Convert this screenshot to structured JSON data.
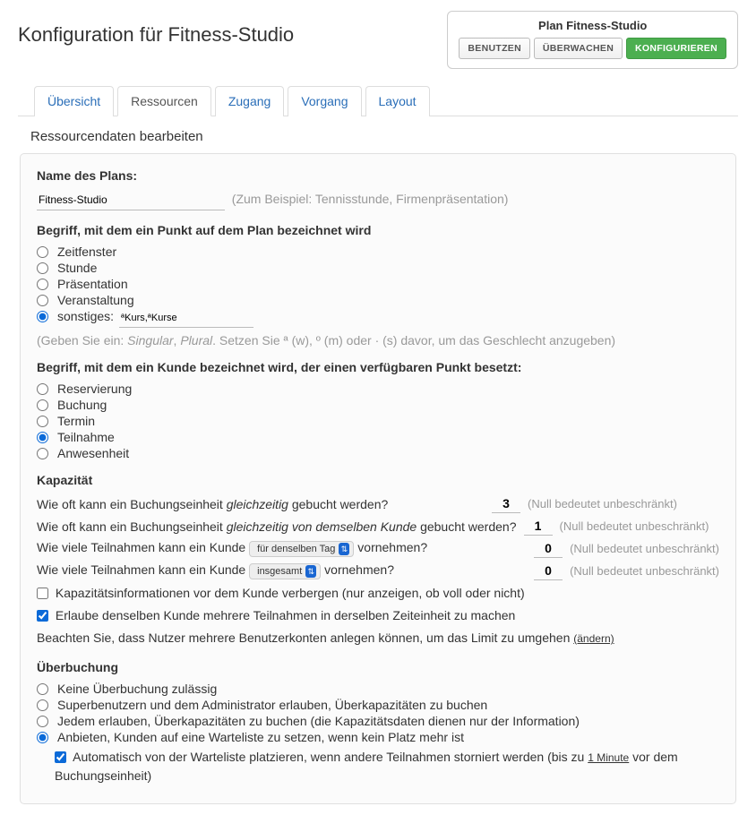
{
  "page_title": "Konfiguration für Fitness-Studio",
  "plan_box": {
    "title": "Plan Fitness-Studio",
    "buttons": {
      "use": "Benutzen",
      "watch": "Überwachen",
      "configure": "Konfigurieren"
    }
  },
  "tabs": [
    "Übersicht",
    "Ressourcen",
    "Zugang",
    "Vorgang",
    "Layout"
  ],
  "active_tab": 1,
  "subheading": "Ressourcendaten bearbeiten",
  "name": {
    "label": "Name des Plans:",
    "value": "Fitness-Studio",
    "hint": "(Zum Beispiel: Tennisstunde, Firmenpräsentation)"
  },
  "point_term": {
    "label": "Begriff, mit dem ein Punkt auf dem Plan bezeichnet wird",
    "options": [
      "Zeitfenster",
      "Stunde",
      "Präsentation",
      "Veranstaltung"
    ],
    "other_label": "sonstiges:",
    "other_value": "ªKurs,ªKurse",
    "hint_prefix": "(Geben Sie ein: ",
    "hint_mid1": "Singular",
    "hint_sep": ", ",
    "hint_mid2": "Plural",
    "hint_suffix": ". Setzen Sie ª (w), º (m) oder · (s) davor, um das Geschlecht anzugeben)",
    "selected": "other"
  },
  "customer_term": {
    "label": "Begriff, mit dem ein Kunde bezeichnet wird, der einen verfügbaren Punkt besetzt:",
    "options": [
      "Reservierung",
      "Buchung",
      "Termin",
      "Teilnahme",
      "Anwesenheit"
    ],
    "selected": 3
  },
  "capacity": {
    "title": "Kapazität",
    "row1_a": "Wie oft kann ein Buchungseinheit ",
    "row1_b": "gleichzeitig",
    "row1_c": " gebucht werden?",
    "val1": "3",
    "row2_a": "Wie oft kann ein Buchungseinheit ",
    "row2_b": "gleichzeitig von demselben Kunde",
    "row2_c": " gebucht werden?",
    "val2": "1",
    "row3_a": "Wie viele Teilnahmen kann ein Kunde ",
    "row3_b": " vornehmen?",
    "sel3": "für denselben Tag",
    "val3": "0",
    "row4_a": "Wie viele Teilnahmen kann ein Kunde ",
    "row4_b": " vornehmen?",
    "sel4": "insgesamt",
    "val4": "0",
    "hint": "(Null bedeutet unbeschränkt)",
    "hide_label": "Kapazitätsinformationen vor dem Kunde verbergen (nur anzeigen, ob voll oder nicht)",
    "hide_checked": false,
    "multi_label": "Erlaube denselben Kunde mehrere Teilnahmen in derselben Zeiteinheit zu machen",
    "multi_checked": true,
    "note_a": "Beachten Sie, dass Nutzer mehrere Benutzerkonten anlegen können, um das Limit zu umgehen ",
    "note_link": "(ändern)"
  },
  "overbook": {
    "title": "Überbuchung",
    "options": [
      "Keine Überbuchung zulässig",
      "Superbenutzern und dem Administrator erlauben, Überkapazitäten zu buchen",
      "Jedem erlauben, Überkapazitäten zu buchen (die Kapazitätsdaten dienen nur der Information)",
      "Anbieten, Kunden auf eine Warteliste zu setzen, wenn kein Platz mehr ist"
    ],
    "selected": 3,
    "auto_a": "Automatisch von der Warteliste platzieren, wenn andere Teilnahmen storniert werden (bis zu ",
    "auto_link": "1 Minute",
    "auto_b": " vor dem Buchungseinheit)",
    "auto_checked": true
  }
}
